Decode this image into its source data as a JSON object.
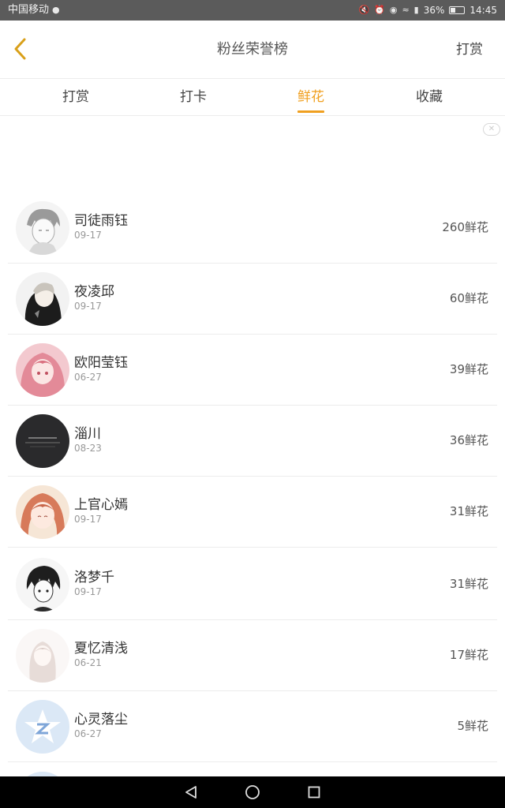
{
  "status_bar": {
    "carrier": "中国移动",
    "battery_percent": "36%",
    "battery_level": 0.36,
    "time": "14:45",
    "icons": [
      "qq-icon",
      "mute-icon",
      "alarm-icon",
      "eye-icon",
      "wifi-icon",
      "signal-icon",
      "battery-icon"
    ]
  },
  "header": {
    "title": "粉丝荣誉榜",
    "action_label": "打赏"
  },
  "tabs": [
    {
      "label": "打赏",
      "active": false
    },
    {
      "label": "打卡",
      "active": false
    },
    {
      "label": "鲜花",
      "active": true
    },
    {
      "label": "收藏",
      "active": false
    }
  ],
  "colors": {
    "accent": "#f0a020",
    "status_bar": "#5b5b5b",
    "nav_bar": "#000000"
  },
  "fans": [
    {
      "name": "司徒雨钰",
      "date": "09-17",
      "count": "260鲜花",
      "avatar": "sketch-boy-avatar"
    },
    {
      "name": "夜凌邱",
      "date": "09-17",
      "count": "60鲜花",
      "avatar": "hooded-boy-avatar"
    },
    {
      "name": "欧阳莹钰",
      "date": "06-27",
      "count": "39鲜花",
      "avatar": "pink-hair-girl-avatar"
    },
    {
      "name": "淄川",
      "date": "08-23",
      "count": "36鲜花",
      "avatar": "dark-text-avatar"
    },
    {
      "name": "上官心嫣",
      "date": "09-17",
      "count": "31鲜花",
      "avatar": "red-hair-girl-avatar"
    },
    {
      "name": "洛梦千",
      "date": "09-17",
      "count": "31鲜花",
      "avatar": "manga-boy-avatar"
    },
    {
      "name": "夏忆清浅",
      "date": "06-21",
      "count": "17鲜花",
      "avatar": "pale-girl-avatar"
    },
    {
      "name": "心灵落尘",
      "date": "06-27",
      "count": "5鲜花",
      "avatar": "qzone-default-avatar"
    }
  ]
}
